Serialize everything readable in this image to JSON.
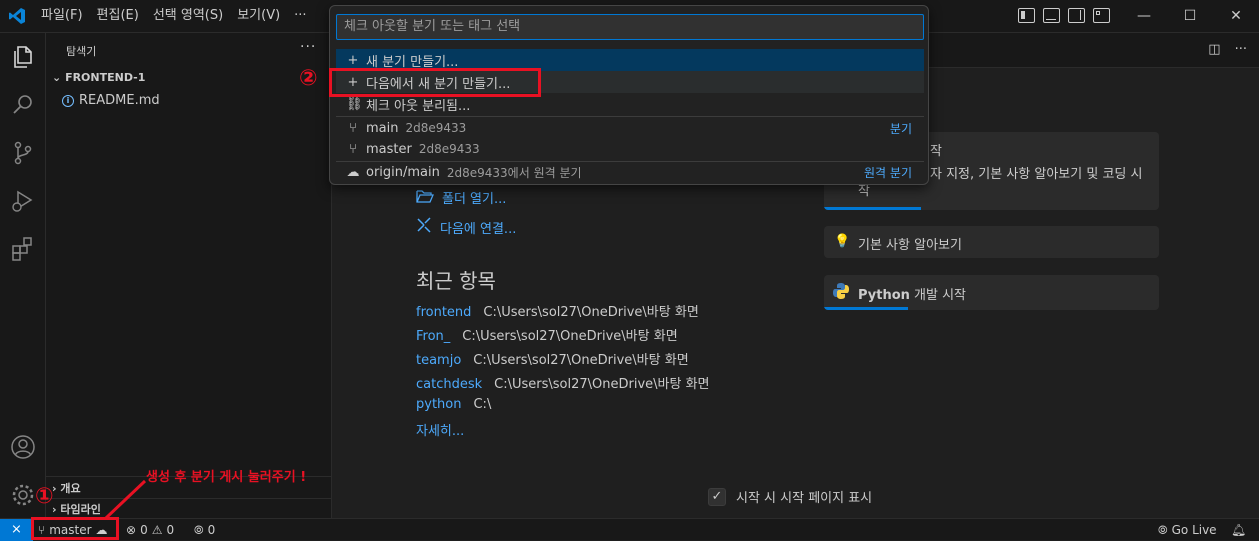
{
  "menu": [
    "파일(F)",
    "편집(E)",
    "선택 영역(S)",
    "보기(V)",
    "···"
  ],
  "sidebar": {
    "title": "탐색기",
    "more": "···",
    "folder": "FRONTEND-1",
    "file": "README.md",
    "sections": [
      "개요",
      "타임라인"
    ]
  },
  "quickpick": {
    "placeholder": "체크 아웃할 분기 또는 태그 선택",
    "items": [
      {
        "icon": "plus-icon",
        "label": "새 분기 만들기..."
      },
      {
        "icon": "plus-icon",
        "label": "다음에서 새 분기 만들기..."
      },
      {
        "icon": "detach-icon",
        "label": "체크 아웃 분리됨..."
      },
      {
        "icon": "branch-icon",
        "label": "main",
        "desc": "2d8e9433",
        "right": "분기"
      },
      {
        "icon": "branch-icon",
        "label": "master",
        "desc": "2d8e9433"
      },
      {
        "icon": "cloud-icon",
        "label": "origin/main",
        "desc": "2d8e9433에서 원격 분기",
        "right": "원격 분기"
      }
    ]
  },
  "welcome": {
    "open_folder": "폴더 열기...",
    "connect": "다음에 연결...",
    "recent_title": "최근 항목",
    "recent": [
      {
        "name": "frontend",
        "path": "C:\\Users\\sol27\\OneDrive\\바탕 화면"
      },
      {
        "name": "Fron_",
        "path": "C:\\Users\\sol27\\OneDrive\\바탕 화면"
      },
      {
        "name": "teamjo",
        "path": "C:\\Users\\sol27\\OneDrive\\바탕 화면"
      },
      {
        "name": "catchdesk",
        "path": "C:\\Users\\sol27\\OneDrive\\바탕 화면"
      },
      {
        "name": "python",
        "path": "C:\\"
      }
    ],
    "more": "자세히...",
    "walkthrough1_title": "작",
    "walkthrough1_desc1": "자 지정, 기본 사항 알아보기 및 코딩 시",
    "walkthrough1_desc2": "작",
    "walkthrough2": "기본 사항 알아보기",
    "walkthrough3_bold": "Python",
    "walkthrough3_rest": " 개발 시작",
    "startup_label": "시작 시 시작 페이지 표시",
    "walkthrough1_progress": 0.29,
    "walkthrough3_progress": 0.25
  },
  "statusbar": {
    "branch": "master",
    "errors": "0",
    "warnings": "0",
    "ports": "0",
    "golive": "Go Live"
  },
  "annotations": {
    "circle1": "①",
    "circle2": "②",
    "note": "생성 후 분기 게시 눌러주기 !"
  },
  "colors": {
    "accent": "#0078d4",
    "link": "#4daafc",
    "annotation": "#e81123"
  }
}
